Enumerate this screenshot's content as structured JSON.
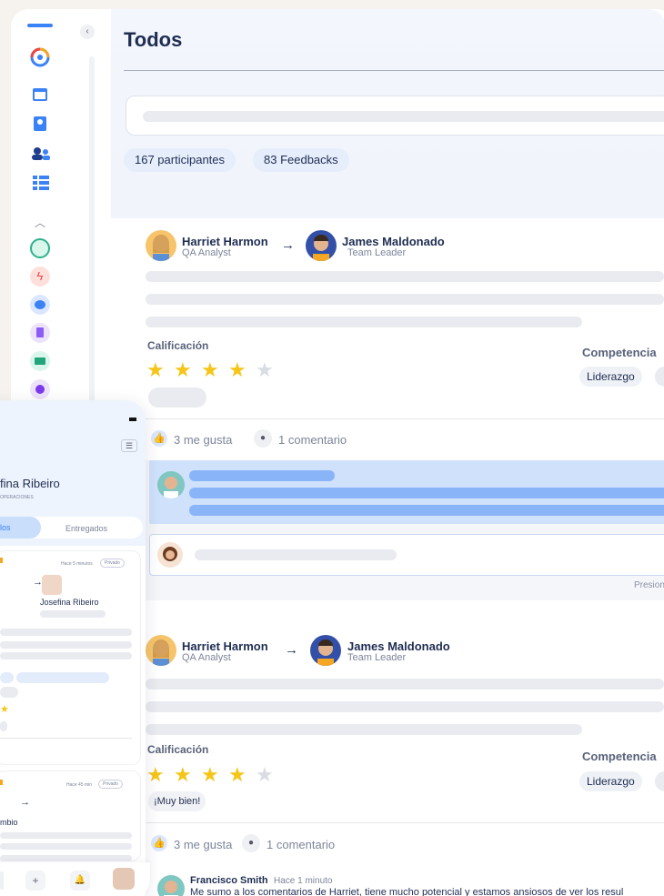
{
  "header": {
    "title": "Todos"
  },
  "stats": {
    "participants": "167 participantes",
    "feedbacks": "83 Feedbacks"
  },
  "feedback1": {
    "from_name": "Harriet Harmon",
    "from_role": "QA Analyst",
    "to_name": "James Maldonado",
    "to_role": "Team Leader",
    "rating_label": "Calificación",
    "rating": 4,
    "rating_max": 5,
    "competencies_label": "Competencia",
    "tag": "Liderazgo",
    "likes": "3 me gusta",
    "comments": "1 comentario",
    "hint": "Presion"
  },
  "feedback2": {
    "from_name": "Harriet Harmon",
    "from_role": "QA Analyst",
    "to_name": "James Maldonado",
    "to_role": "Team Leader",
    "rating_label": "Calificación",
    "rating": 4,
    "rating_max": 5,
    "competencies_label": "Competencia",
    "tag": "Liderazgo",
    "comment_badge": "¡Muy bien!",
    "likes": "3 me gusta",
    "comments": "1 comentario",
    "commenter": "Francisco Smith",
    "comment_time": "Hace 1 minuto",
    "comment_text": "Me sumo a los comentarios de Harriet, tiene mucho potencial y estamos ansiosos de ver los resul"
  },
  "mobile": {
    "user_name": "fina Ribeiro",
    "user_sub": "OPERACIONES",
    "tab_left": "los",
    "tab_right": "Entregados",
    "card1_time": "Hace 5 minutos",
    "card1_privacy": "Privado",
    "card1_to": "Josefina Ribeiro",
    "card2_time": "Hace 45 min",
    "card2_privacy": "Privado",
    "card2_to": "mbio",
    "nav_plus": "+"
  },
  "colors": {
    "accent": "#3b82f6",
    "star": "#f5c518",
    "star_empty": "#d9dce3",
    "navy": "#1f2d52"
  }
}
